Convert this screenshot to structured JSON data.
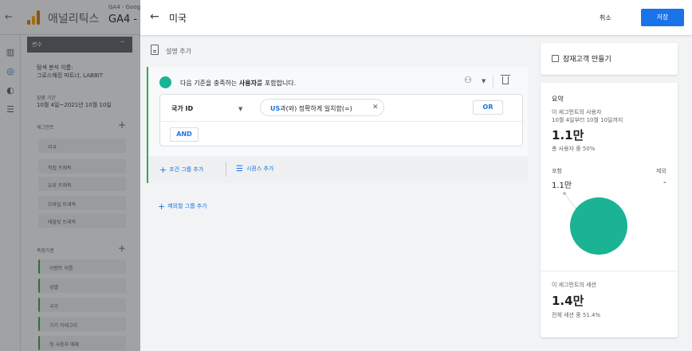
{
  "background": {
    "brand": "애널리틱스",
    "account": "GA4 - Goog",
    "property": "GA4 -",
    "panel_header": "변수",
    "analysis_name_label": "탐색 분석 이름:",
    "analysis_name": "그로스해킹 파트너, LABBIT",
    "date_label": "맞춤 기간",
    "date_range": "10월 4일~2021년 10월 10일",
    "segments_title": "세그먼트",
    "segments": [
      "미국",
      "직접 트래픽",
      "유료 트래픽",
      "모바일 트래픽",
      "태블릿 트래픽"
    ],
    "dimensions_title": "측정기준",
    "dimensions": [
      "이벤트 이름",
      "성별",
      "국가",
      "기기 카테고리",
      "첫 사용자 매체"
    ]
  },
  "topbar": {
    "segment_name": "미국",
    "cancel_label": "취소",
    "save_label": "저장"
  },
  "description": {
    "add_label": "설명 추가"
  },
  "condition": {
    "include_prefix": "다음 기준을 충족하는 ",
    "include_bold": "사용자",
    "include_suffix": "를 포함합니다.",
    "dimension": "국가 ID",
    "filter_value": "US",
    "filter_rest": "과(와) 정확하게 일치함(=)",
    "or_label": "OR",
    "and_label": "AND",
    "add_group": "조건 그룹 추가",
    "add_sequence": "시퀀스 추가",
    "add_exclude_group": "제외할 그룹 추가"
  },
  "audience": {
    "label": "잠재고객 만들기"
  },
  "summary": {
    "title": "요약",
    "users_label": "이 세그먼트의 사용자",
    "date_text": "10월 4일부터 10월 10일까지",
    "users_value": "1.1만",
    "users_share": "총 사용자 중 50%",
    "include_label": "포함",
    "exclude_label": "제외",
    "include_value": "1.1만",
    "exclude_value": "-",
    "sessions_label": "이 세그먼트의 세션",
    "sessions_value": "1.4만",
    "sessions_share": "전체 세션 중 51.4%",
    "pie_color": "#1ab394"
  },
  "colors": {
    "accent": "#1a73e8",
    "include_green": "#34a853"
  }
}
